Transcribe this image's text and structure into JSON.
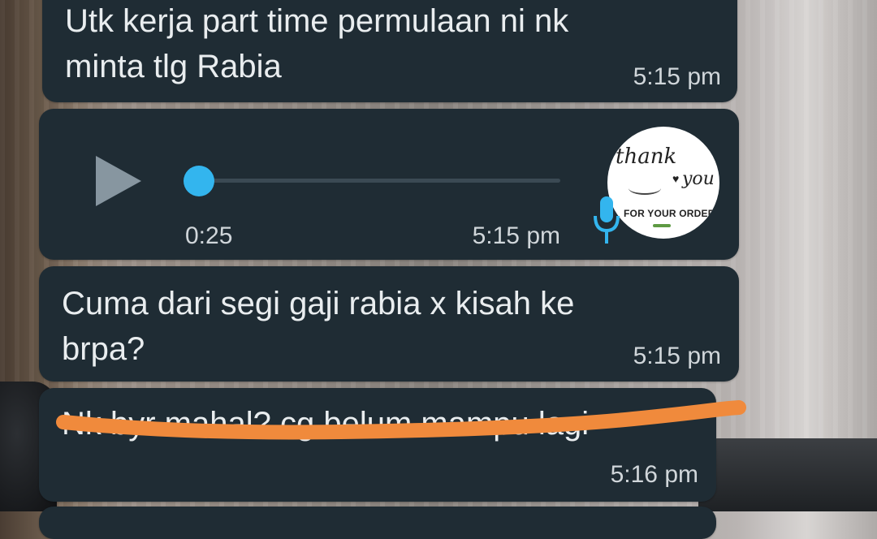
{
  "messages": [
    {
      "text": "Utk kerja part time permulaan ni nk\nminta tlg Rabia",
      "time": "5:15 pm"
    },
    {
      "text": "Cuma dari segi gaji rabia x kisah ke\nbrpa?",
      "time": "5:15 pm"
    },
    {
      "text": "Nk byr mahal? cg belum mampu lagi",
      "time": "5:16 pm",
      "redacted": true
    }
  ],
  "voice_note": {
    "duration": "0:25",
    "time": "5:15 pm",
    "progress": 0,
    "avatar": {
      "thank": "thank",
      "you": "you",
      "order": "FOR YOUR ORDER!"
    }
  },
  "colors": {
    "bubble": "#1f2c34",
    "text": "#e9edef",
    "accent": "#33b5ee",
    "scribble": "#f08a3c"
  },
  "icons": [
    "play-icon",
    "mic-icon",
    "heart-icon"
  ]
}
